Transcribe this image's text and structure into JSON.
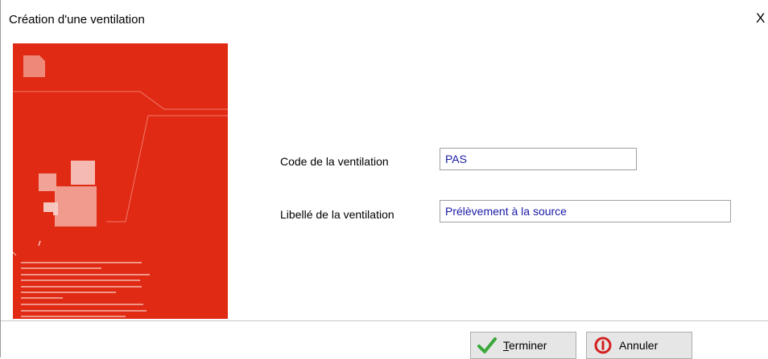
{
  "window": {
    "title": "Création d'une ventilation",
    "close_glyph": "X"
  },
  "form": {
    "code_label": "Code de la ventilation",
    "code_value": "PAS",
    "libelle_label": "Libellé de la ventilation",
    "libelle_value": "Prélèvement à la source"
  },
  "buttons": {
    "terminer_mnemonic": "T",
    "terminer_rest": "erminer",
    "annuler_label": "Annuler"
  },
  "icons": {
    "terminer": "checkmark-icon",
    "annuler": "cancel-circle-icon",
    "close": "close-icon"
  },
  "colors": {
    "banner": "#e02a14",
    "input_text": "#1a1aa8",
    "check_green": "#3aa83a",
    "cancel_red": "#d42020"
  }
}
